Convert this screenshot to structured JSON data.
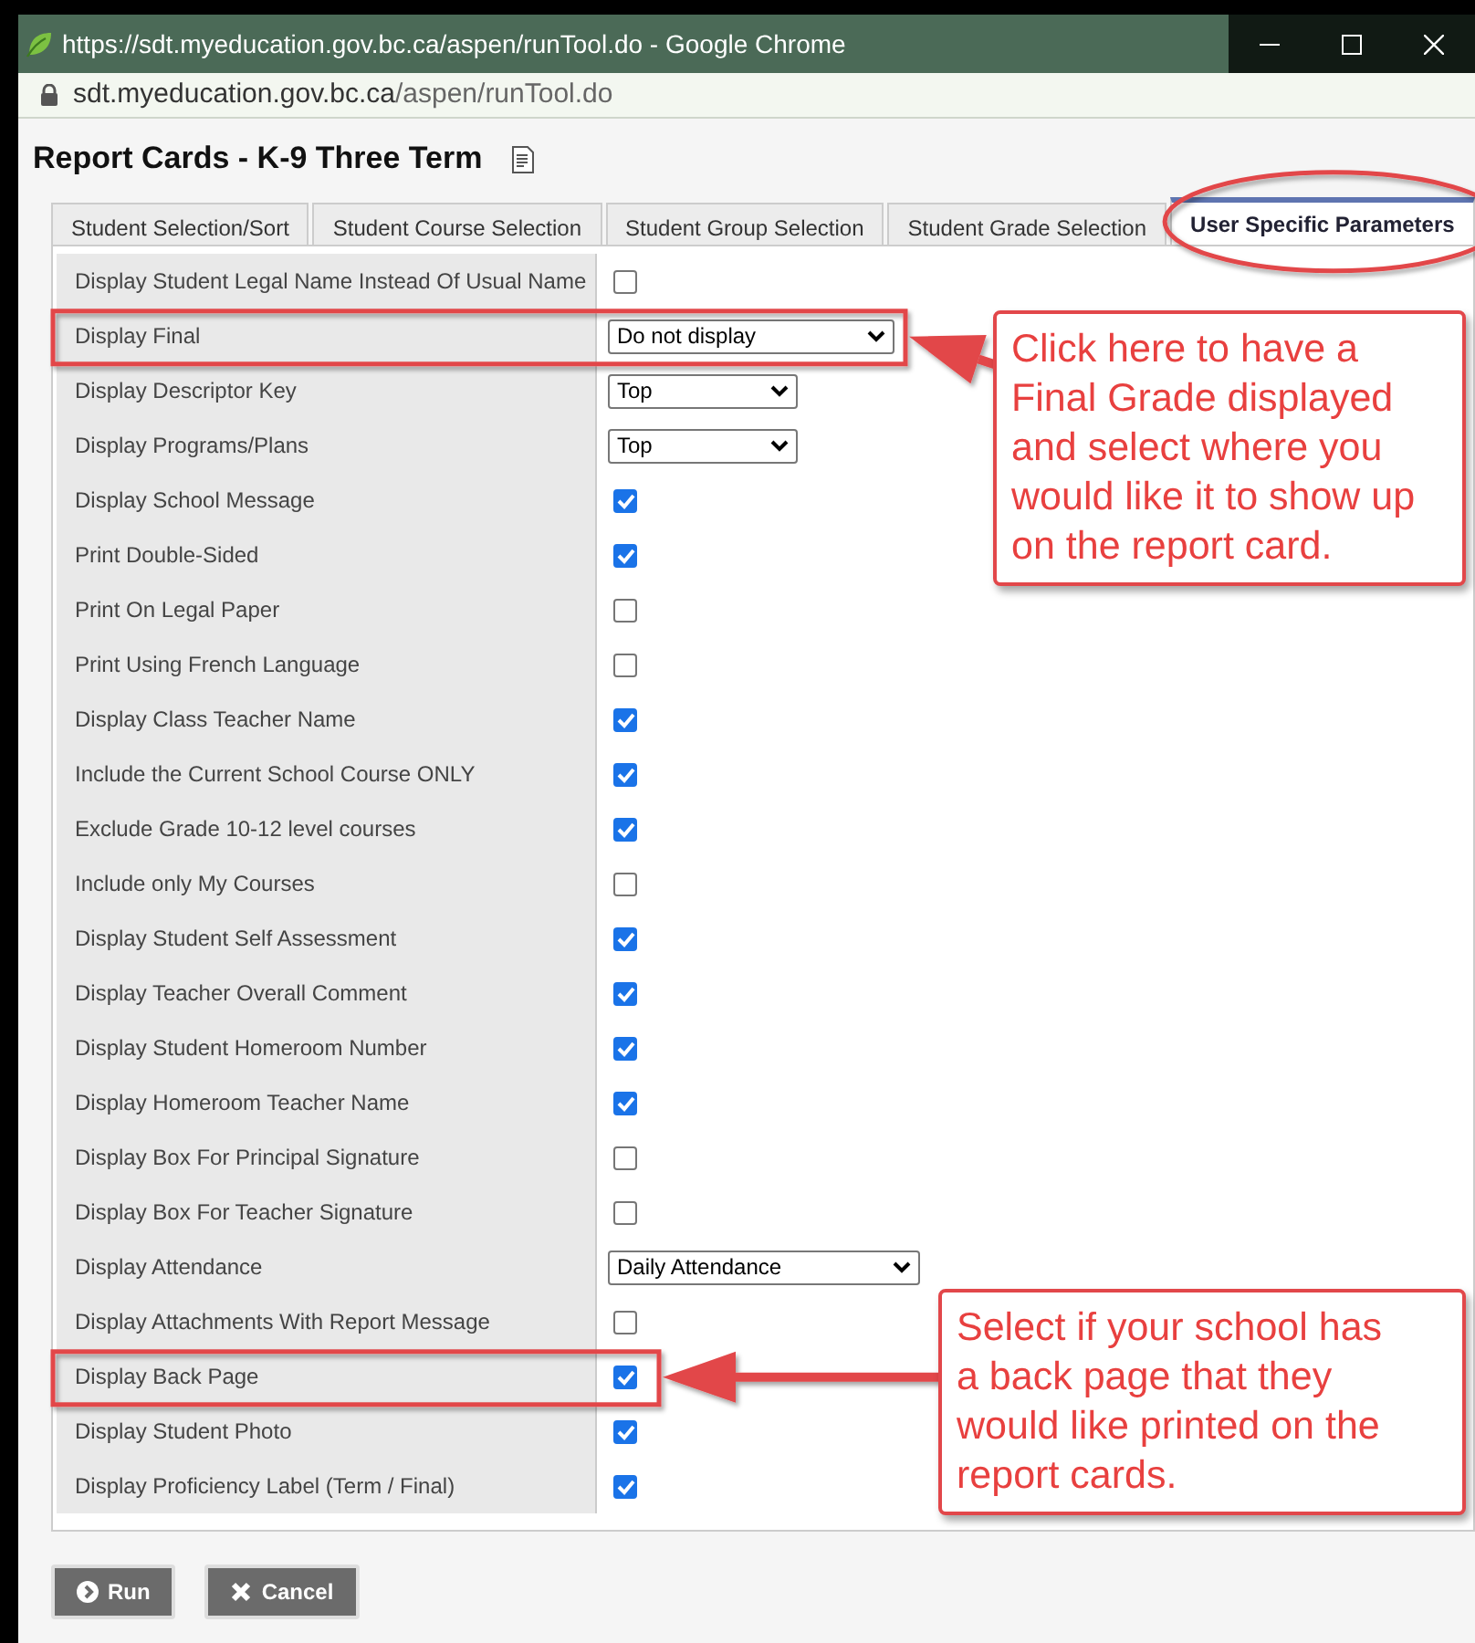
{
  "browser": {
    "title": "https://sdt.myeducation.gov.bc.ca/aspen/runTool.do - Google Chrome",
    "url_host": "sdt.myeducation.gov.bc.ca",
    "url_path": "/aspen/runTool.do"
  },
  "page": {
    "title": "Report Cards - K-9 Three Term"
  },
  "tabs": [
    {
      "label": "Student Selection/Sort",
      "selected": false,
      "circled": false
    },
    {
      "label": "Student Course Selection",
      "selected": false,
      "circled": false
    },
    {
      "label": "Student Group Selection",
      "selected": false,
      "circled": false
    },
    {
      "label": "Student Grade Selection",
      "selected": false,
      "circled": false
    },
    {
      "label": "User Specific Parameters",
      "selected": true,
      "circled": true
    }
  ],
  "parameters": [
    {
      "label": "Display Student Legal Name Instead Of Usual Name",
      "kind": "checkbox",
      "checked": false
    },
    {
      "label": "Display Final",
      "kind": "select",
      "value": "Do not display",
      "highlighted": true,
      "callout": "Click here to have a Final Grade displayed and select where you would like it to show up on the report card."
    },
    {
      "label": "Display Descriptor Key",
      "kind": "select",
      "value": "Top"
    },
    {
      "label": "Display Programs/Plans",
      "kind": "select",
      "value": "Top"
    },
    {
      "label": "Display School Message",
      "kind": "checkbox",
      "checked": true
    },
    {
      "label": "Print Double-Sided",
      "kind": "checkbox",
      "checked": true
    },
    {
      "label": "Print On Legal Paper",
      "kind": "checkbox",
      "checked": false
    },
    {
      "label": "Print Using French Language",
      "kind": "checkbox",
      "checked": false
    },
    {
      "label": "Display Class Teacher Name",
      "kind": "checkbox",
      "checked": true
    },
    {
      "label": "Include the Current School Course ONLY",
      "kind": "checkbox",
      "checked": true
    },
    {
      "label": "Exclude Grade 10-12 level courses",
      "kind": "checkbox",
      "checked": true
    },
    {
      "label": "Include only My Courses",
      "kind": "checkbox",
      "checked": false
    },
    {
      "label": "Display Student Self Assessment",
      "kind": "checkbox",
      "checked": true
    },
    {
      "label": "Display Teacher Overall Comment",
      "kind": "checkbox",
      "checked": true
    },
    {
      "label": "Display Student Homeroom Number",
      "kind": "checkbox",
      "checked": true
    },
    {
      "label": "Display Homeroom Teacher Name",
      "kind": "checkbox",
      "checked": true
    },
    {
      "label": "Display Box For Principal Signature",
      "kind": "checkbox",
      "checked": false
    },
    {
      "label": "Display Box For Teacher Signature",
      "kind": "checkbox",
      "checked": false
    },
    {
      "label": "Display Attendance",
      "kind": "select",
      "value": "Daily Attendance"
    },
    {
      "label": "Display Attachments With Report Message",
      "kind": "checkbox",
      "checked": false
    },
    {
      "label": "Display Back Page",
      "kind": "checkbox",
      "checked": true,
      "highlighted": true,
      "callout": "Select if your school has a back page that they would like printed on the report cards."
    },
    {
      "label": "Display Student Photo",
      "kind": "checkbox",
      "checked": true
    },
    {
      "label": "Display Proficiency Label (Term / Final)",
      "kind": "checkbox",
      "checked": true
    }
  ],
  "buttons": [
    {
      "label": "Run",
      "kind": "run"
    },
    {
      "label": "Cancel",
      "kind": "cancel"
    }
  ]
}
